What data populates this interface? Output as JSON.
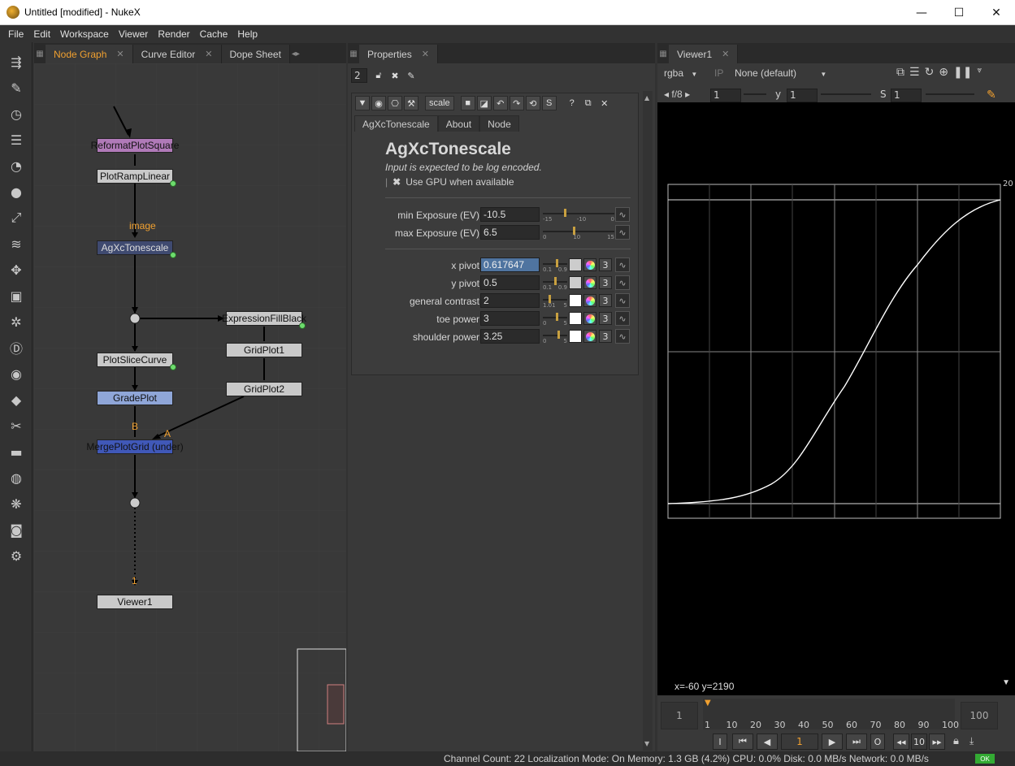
{
  "window": {
    "title": "Untitled [modified] - NukeX",
    "minimize": "—",
    "maximize": "☐",
    "close": "✕"
  },
  "menu": [
    "File",
    "Edit",
    "Workspace",
    "Viewer",
    "Render",
    "Cache",
    "Help"
  ],
  "left_tabs": {
    "node_graph": "Node Graph",
    "curve_editor": "Curve Editor",
    "dope_sheet": "Dope Sheet"
  },
  "properties_tab": "Properties",
  "viewer_tab": "Viewer1",
  "nodes": {
    "reformat": "ReformatPlotSquare",
    "ramp": "PlotRampLinear",
    "image_label": "image",
    "tonescale": "AgXcTonescale",
    "exprfill": "ExpressionFillBlack",
    "grid1": "GridPlot1",
    "grid2": "GridPlot2",
    "slicecurve": "PlotSliceCurve",
    "gradeplot": "GradePlot",
    "b_label": "B",
    "a_label": "A",
    "merge": "MergePlotGrid (under)",
    "one_label": "1",
    "viewer": "Viewer1"
  },
  "properties": {
    "count": "2",
    "scale_btn": "scale",
    "s_btn": "S",
    "help_btn": "?",
    "tabs": [
      "AgXcTonescale",
      "About",
      "Node"
    ],
    "node_title": "AgXcTonescale",
    "subtitle": "Input is expected to be log encoded.",
    "gpu_label": "Use GPU when available",
    "knobs": [
      {
        "label": "min Exposure (EV)",
        "value": "-10.5",
        "ticks": [
          "-15",
          "-10",
          "0"
        ],
        "level": 0.3
      },
      {
        "label": "max Exposure (EV)",
        "value": "6.5",
        "ticks": [
          "0",
          "10",
          "15"
        ],
        "level": 0.43
      },
      {
        "label": "x pivot",
        "value": "0.617647",
        "ticks": [
          "0.1",
          "0.9"
        ],
        "level": 0.6
      },
      {
        "label": "y pivot",
        "value": "0.5",
        "ticks": [
          "0.1",
          "0.9"
        ],
        "level": 0.5
      },
      {
        "label": "general contrast",
        "value": "2",
        "ticks": [
          "1.01",
          "5"
        ],
        "level": 0.25
      },
      {
        "label": "toe power",
        "value": "3",
        "ticks": [
          "0",
          "5"
        ],
        "level": 0.6
      },
      {
        "label": "shoulder power",
        "value": "3.25",
        "ticks": [
          "0",
          "5"
        ],
        "level": 0.65
      }
    ],
    "channel_count": "3"
  },
  "viewer": {
    "channels": "rgba",
    "ip": "IP",
    "lut": "None (default)",
    "fstop": "f/8",
    "frame_val": "1",
    "y_label": "y",
    "y_val": "1",
    "s_label": "S",
    "s_val": "1",
    "top_right_label": "20",
    "coords": "x=-60 y=2190",
    "timeline_ticks": [
      "1",
      "10",
      "20",
      "30",
      "40",
      "50",
      "60",
      "70",
      "80",
      "90",
      "100"
    ],
    "timeline_start": "1",
    "timeline_end": "100",
    "current_frame": "1",
    "step": "10",
    "btn_in": "I",
    "btn_out": "O",
    "ok": "OK"
  },
  "status": "Channel Count: 22  Localization Mode: On  Memory: 1.3 GB (4.2%)  CPU: 0.0%  Disk: 0.0 MB/s  Network: 0.0 MB/s",
  "colors": {
    "accent_orange": "#f0a030",
    "node_selected": "#4f74a0"
  }
}
